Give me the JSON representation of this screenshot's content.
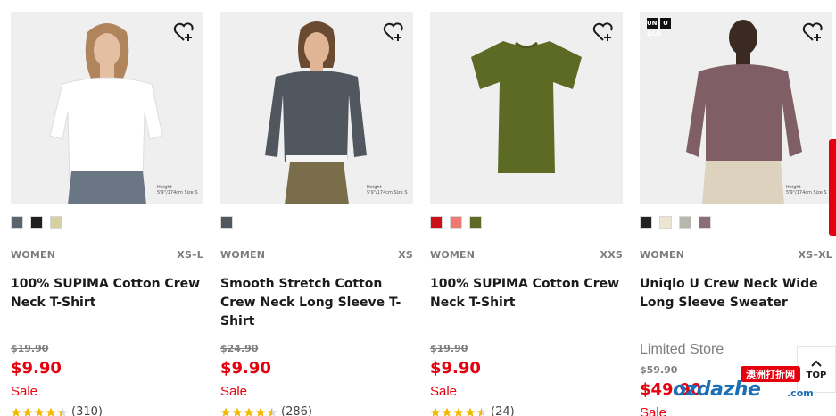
{
  "products": [
    {
      "photo_bg": "#eeeeee",
      "top_color": "#ffffff",
      "swatches": [
        "#5a646e",
        "#1f1f1f",
        "#d7d0a0"
      ],
      "gender": "WOMEN",
      "sizes": "XS–L",
      "name": "100% SUPIMA Cotton Crew Neck T-Shirt",
      "store": "",
      "was_price": "$19.90",
      "price": "$9.90",
      "sale": "Sale",
      "rating": 4.5,
      "reviews": "(310)",
      "size_note": "Height 5'9\"/174cm Size S"
    },
    {
      "photo_bg": "#eeeeee",
      "top_color": "#50575e",
      "swatches": [
        "#50575e"
      ],
      "gender": "WOMEN",
      "sizes": "XS",
      "name": "Smooth Stretch Cotton Crew Neck Long Sleeve T-Shirt",
      "store": "",
      "was_price": "$24.90",
      "price": "$9.90",
      "sale": "Sale",
      "rating": 4.5,
      "reviews": "(286)",
      "size_note": "Height 5'9\"/174cm Size S"
    },
    {
      "photo_bg": "#eeeeee",
      "top_color": "#5d6a24",
      "swatches": [
        "#c91018",
        "#ee7a72",
        "#5d6a24"
      ],
      "gender": "WOMEN",
      "sizes": "XXS",
      "name": "100% SUPIMA Cotton Crew Neck T-Shirt",
      "store": "",
      "was_price": "$19.90",
      "price": "$9.90",
      "sale": "Sale",
      "rating": 4.5,
      "reviews": "(24)",
      "size_note": ""
    },
    {
      "photo_bg": "#eeeeee",
      "top_color": "#7f5f65",
      "swatches": [
        "#222222",
        "#eee4d2",
        "#b5b9ad",
        "#8c6e78"
      ],
      "gender": "WOMEN",
      "sizes": "XS–XL",
      "name": "Uniqlo U Crew Neck Wide Long Sleeve Sweater",
      "store": "Limited Store",
      "was_price": "$59.90",
      "price": "$49.90",
      "sale": "Sale",
      "rating": 0,
      "reviews": "",
      "size_note": "Height 5'9\"/174cm Size S",
      "brand_badge": [
        "UNI QLO",
        "U"
      ]
    }
  ],
  "back_to_top": {
    "label": "TOP",
    "icon": "chevron-up-icon"
  },
  "watermark": {
    "top_text": "澳洲打折网",
    "main_text": "ozdazhe",
    "suffix": ".com"
  },
  "colors": {
    "sale_red": "#e4000f",
    "muted_gray": "#7d7d7d"
  }
}
